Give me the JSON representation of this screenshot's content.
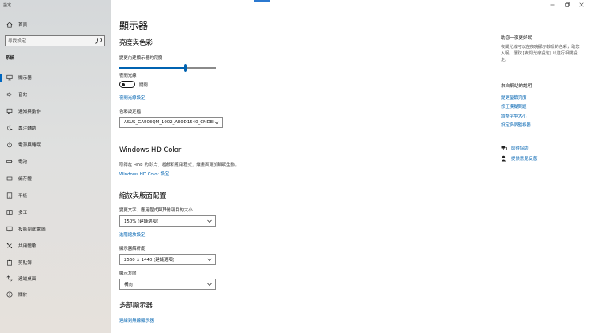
{
  "window": {
    "app_title": "設定",
    "minimize_label": "minimize",
    "maximize_label": "maximize",
    "close_label": "close"
  },
  "sidebar": {
    "home_label": "首頁",
    "search_placeholder": "尋找設定",
    "section_label": "系統",
    "items": [
      {
        "label": "顯示器",
        "icon": "monitor-icon"
      },
      {
        "label": "音效",
        "icon": "speaker-icon"
      },
      {
        "label": "通知與動作",
        "icon": "notification-icon"
      },
      {
        "label": "專注輔助",
        "icon": "moon-icon"
      },
      {
        "label": "電源與睡眠",
        "icon": "power-icon"
      },
      {
        "label": "電池",
        "icon": "battery-icon"
      },
      {
        "label": "儲存體",
        "icon": "storage-icon"
      },
      {
        "label": "平板",
        "icon": "tablet-icon"
      },
      {
        "label": "多工",
        "icon": "multitask-icon"
      },
      {
        "label": "投影到此電腦",
        "icon": "projector-icon"
      },
      {
        "label": "共用體驗",
        "icon": "shared-icon"
      },
      {
        "label": "剪貼簿",
        "icon": "clipboard-icon"
      },
      {
        "label": "遠端桌面",
        "icon": "remote-icon"
      },
      {
        "label": "關於",
        "icon": "info-icon"
      }
    ],
    "active_index": 0
  },
  "main": {
    "page_title": "顯示器",
    "brightness": {
      "heading": "亮度與色彩",
      "slider_label": "變更內建顯示器的亮度",
      "slider_value": 0.69,
      "night_light_label": "夜間光線",
      "night_light_state": "關閉",
      "night_light_link": "夜間光線設定",
      "color_profile_label": "色彩設定檔",
      "color_profile_value": "ASUS_GA503QM_1002_AEOD1540_CMDEF"
    },
    "hdr": {
      "heading": "Windows HD Color",
      "description": "取得在 HDR 的影片、遊戲和應用程式，讓畫面更加鮮明生動。",
      "link": "Windows HD Color 設定"
    },
    "scale": {
      "heading": "縮放與版面配置",
      "scale_label": "變更文字、應用程式與其他項目的大小",
      "scale_value": "150% (建議選項)",
      "advanced_link": "進階縮放設定",
      "resolution_label": "顯示器解析度",
      "resolution_value": "2560 × 1440 (建議選項)",
      "orientation_label": "顯示方向",
      "orientation_value": "橫向"
    },
    "multi": {
      "heading": "多部顯示器",
      "wireless_link": "連線到無線顯示器"
    }
  },
  "right": {
    "tip_heading": "助您一夜更好眠",
    "tip_text": "夜間光線可以在夜晚顯示較暖的色彩，助您入眠。選取 [夜間光線設定] 以進行相關設定。",
    "help_heading": "來自網站的說明",
    "help_links": [
      "變更螢幕亮度",
      "修正模糊問題",
      "調整字型大小",
      "設定多個監視器"
    ],
    "get_help": "取得協助",
    "feedback": "提供意見反應",
    "accent_color": "#0063b1"
  }
}
